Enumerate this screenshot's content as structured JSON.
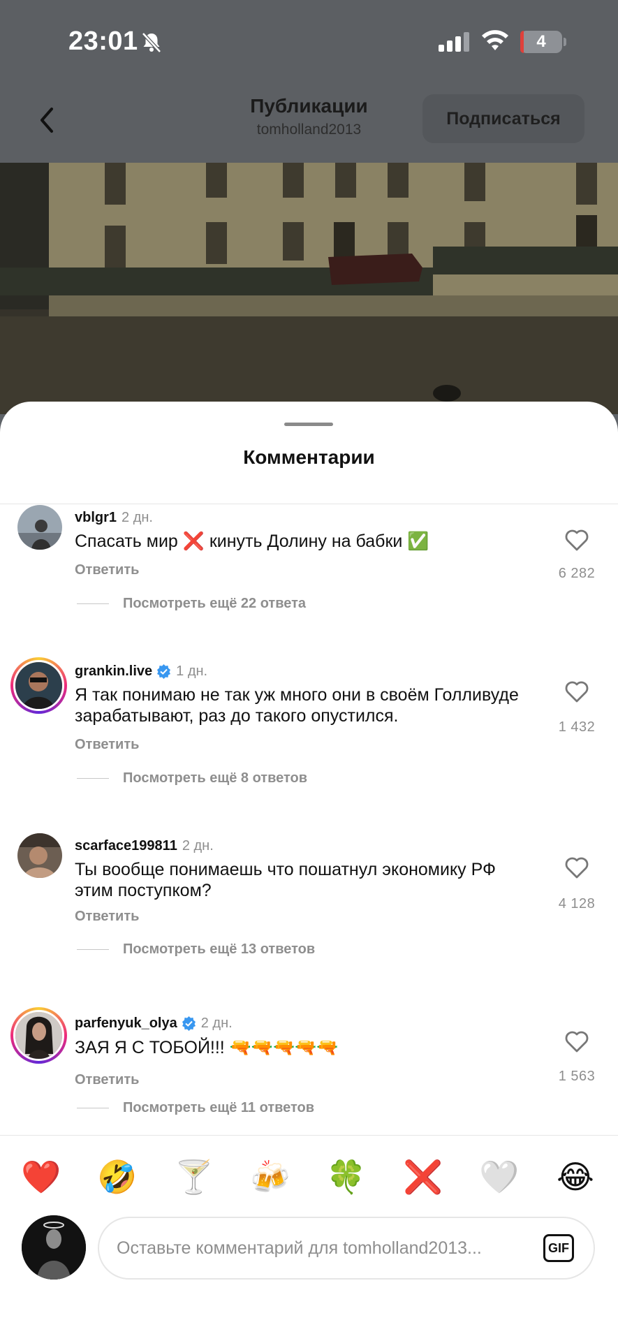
{
  "status_bar": {
    "time": "23:01",
    "battery": "4"
  },
  "header": {
    "title": "Публикации",
    "subtitle": "tomholland2013",
    "follow_label": "Подписаться"
  },
  "sheet": {
    "title": "Комментарии"
  },
  "comments": [
    {
      "username": "vblgr1",
      "verified": false,
      "age": "2 дн.",
      "text": "Спасать мир ❌ кинуть Долину на бабки ✅",
      "reply_label": "Ответить",
      "likes": "6 282",
      "view_replies": "Посмотреть ещё 22 ответа"
    },
    {
      "username": "grankin.live",
      "verified": true,
      "age": "1 дн.",
      "text": "Я так понимаю не так уж много они в своём Голливуде зарабатывают, раз до такого опустился.",
      "reply_label": "Ответить",
      "likes": "1 432",
      "view_replies": "Посмотреть ещё 8 ответов"
    },
    {
      "username": "scarface199811",
      "verified": false,
      "age": "2 дн.",
      "text": "Ты вообще понимаешь что пошатнул экономику РФ этим поступком?",
      "reply_label": "Ответить",
      "likes": "4 128",
      "view_replies": "Посмотреть ещё 13 ответов"
    },
    {
      "username": "parfenyuk_olya",
      "verified": true,
      "age": "2 дн.",
      "text": "ЗАЯ Я С ТОБОЙ!!! 🔫🔫🔫🔫🔫",
      "reply_label": "Ответить",
      "likes": "1 563",
      "view_replies": "Посмотреть ещё 11 ответов"
    }
  ],
  "emoji_reactions": [
    "❤️",
    "🤣",
    "🍸",
    "🍻",
    "🍀",
    "❌",
    "🤍",
    "😂"
  ],
  "input": {
    "placeholder": "Оставьте комментарий для tomholland2013...",
    "gif_label": "GIF"
  },
  "colors": {
    "accent_verified": "#3897f0",
    "muted_text": "#8e8e8e",
    "dim_overlay": "#5c5f63"
  }
}
